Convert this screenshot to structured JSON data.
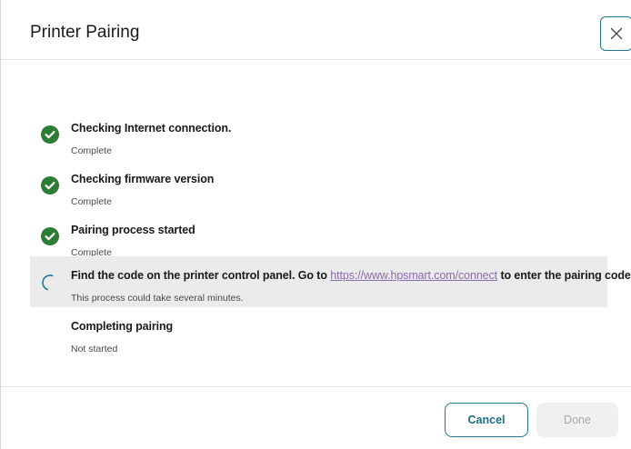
{
  "dialog": {
    "title": "Printer Pairing",
    "close_icon": "close-icon"
  },
  "steps": [
    {
      "label": "Checking Internet connection.",
      "status": "Complete",
      "state": "complete",
      "icon": "check-circle-icon"
    },
    {
      "label": "Checking firmware version",
      "status": "Complete",
      "state": "complete",
      "icon": "check-circle-icon"
    },
    {
      "label": "Pairing process started",
      "status": "Complete",
      "state": "complete",
      "icon": "check-circle-icon"
    },
    {
      "label_before": "Find the code on the printer control panel. Go to",
      "link_text": "https://www.hpsmart.com/connect",
      "label_after": "to enter the pairing code.",
      "status": "This process could take several minutes.",
      "state": "in-progress",
      "icon": "spinner-icon"
    },
    {
      "label": "Completing pairing",
      "status": "Not started",
      "state": "not-started"
    }
  ],
  "footer": {
    "cancel_label": "Cancel",
    "done_label": "Done"
  },
  "colors": {
    "accent": "#1c7a93",
    "success": "#2e7d32",
    "link": "#8a6bb0",
    "active_row": "#ebebeb"
  }
}
